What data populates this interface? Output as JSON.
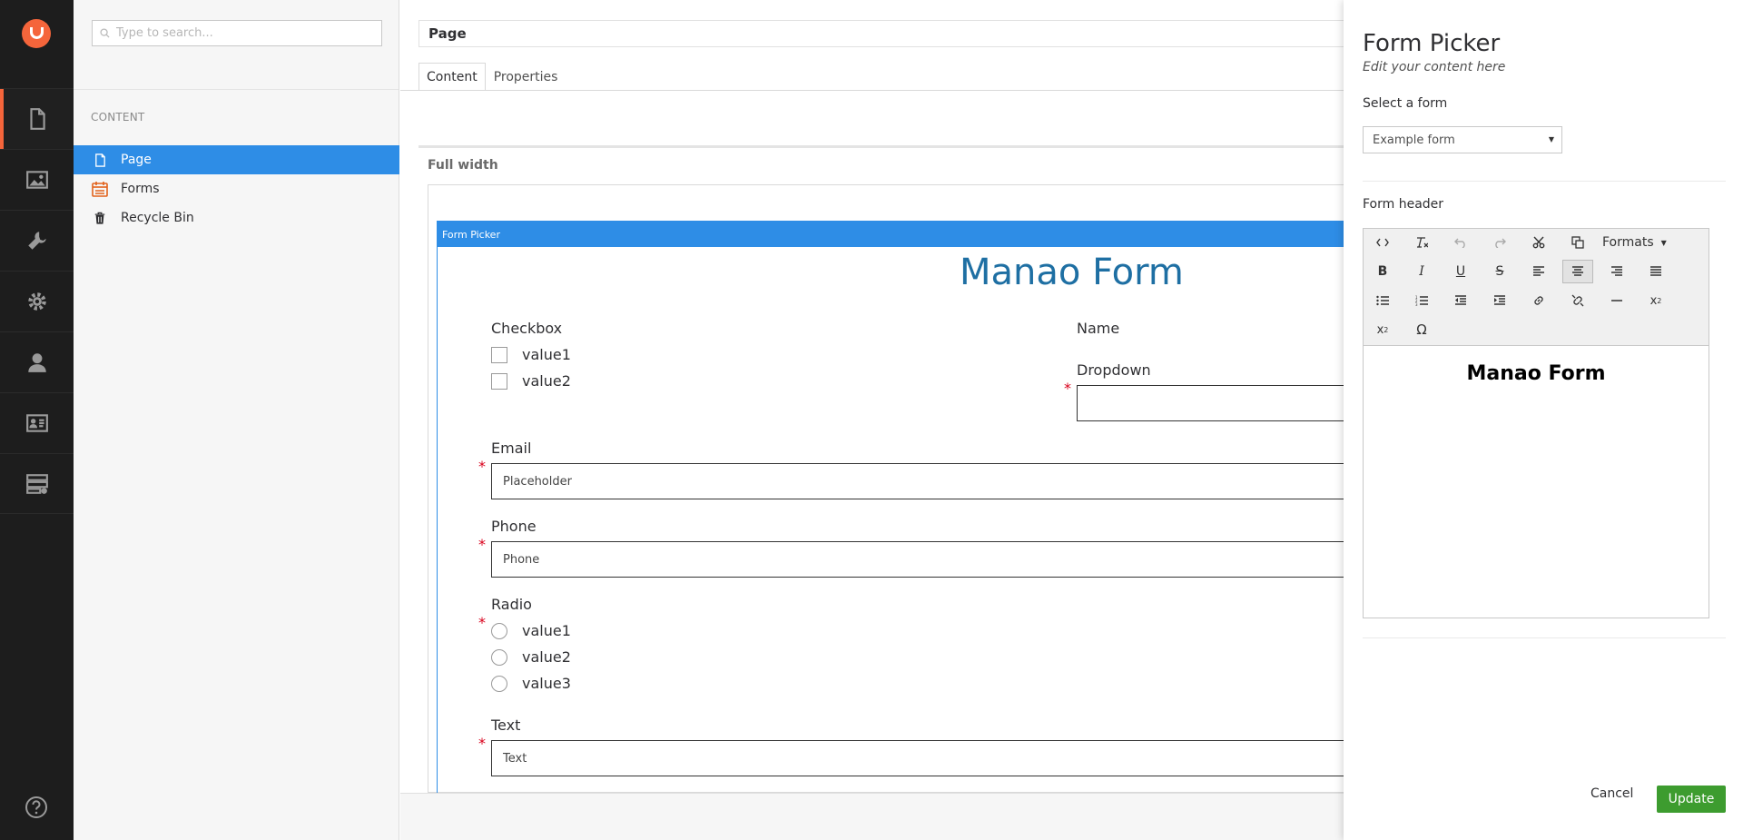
{
  "search": {
    "placeholder": "Type to search..."
  },
  "tree": {
    "header": "CONTENT",
    "items": [
      {
        "label": "Page",
        "icon": "document-icon",
        "selected": true
      },
      {
        "label": "Forms",
        "icon": "forms-icon"
      },
      {
        "label": "Recycle Bin",
        "icon": "trash-icon"
      }
    ]
  },
  "sections": [
    "content-section-icon",
    "media-section-icon",
    "settings-wrench-icon",
    "developer-gear-icon",
    "users-icon",
    "members-icon",
    "forms-section-icon"
  ],
  "editor": {
    "page_name": "Page",
    "tabs": [
      "Content",
      "Properties"
    ],
    "grid_label": "Full width",
    "form_picker_bar": "Form Picker",
    "form_title": "Manao Form",
    "checkbox_label": "Checkbox",
    "checkbox_options": [
      "value1",
      "value2"
    ],
    "name_label": "Name",
    "dropdown_label": "Dropdown",
    "email_label": "Email",
    "email_placeholder": "Placeholder",
    "phone_label": "Phone",
    "phone_placeholder": "Phone",
    "radio_label": "Radio",
    "radio_options": [
      "value1",
      "value2",
      "value3"
    ],
    "text_label": "Text",
    "text_placeholder": "Text",
    "required_mark": "*"
  },
  "overlay": {
    "title": "Form Picker",
    "subtitle": "Edit your content here",
    "select_label": "Select a form",
    "select_value": "Example form",
    "header_label": "Form header",
    "formats_label": "Formats",
    "rte_content": "Manao Form",
    "cancel_label": "Cancel",
    "update_label": "Update"
  },
  "colors": {
    "accent": "#f5653b",
    "selection": "#2e8de6",
    "title_blue": "#1e6fa3",
    "update_green": "#3d9c2f",
    "required_red": "#d9001b"
  }
}
